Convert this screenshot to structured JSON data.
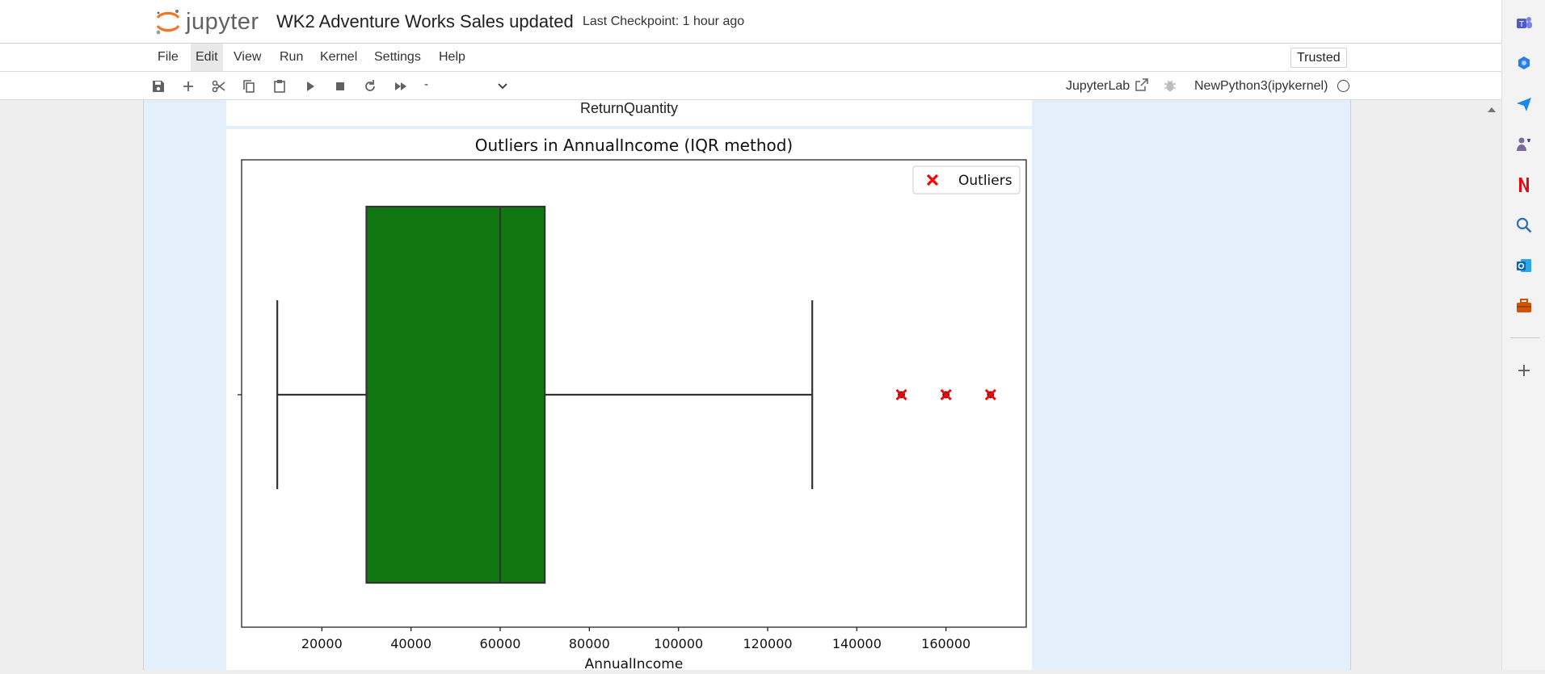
{
  "header": {
    "logo_text": "jupyter",
    "notebook_title": "WK2 Adventure Works Sales updated",
    "checkpoint": "Last Checkpoint: 1 hour ago"
  },
  "menu": {
    "items": [
      "File",
      "Edit",
      "View",
      "Run",
      "Kernel",
      "Settings",
      "Help"
    ],
    "active": "Edit",
    "trusted": "Trusted"
  },
  "toolbar": {
    "cell_type": "-",
    "jupyterlab_label": "JupyterLab",
    "kernel_name": "NewPython3(ipykernel)",
    "icons": [
      "save-icon",
      "add-icon",
      "cut-icon",
      "copy-icon",
      "paste-icon",
      "run-icon",
      "stop-icon",
      "restart-icon",
      "run-all-icon"
    ]
  },
  "previous_output": {
    "label": "ReturnQuantity"
  },
  "chart_data": {
    "type": "box",
    "title": "Outliers in AnnualIncome (IQR method)",
    "xlabel": "AnnualIncome",
    "ylabel": "",
    "xlim": [
      2000,
      178000
    ],
    "xticks": [
      20000,
      40000,
      60000,
      80000,
      100000,
      120000,
      140000,
      160000
    ],
    "box": {
      "whisker_low": 10000,
      "q1": 30000,
      "median": 60000,
      "q3": 70000,
      "whisker_high": 130000,
      "color": "#117711"
    },
    "outliers": [
      150000,
      160000,
      170000
    ],
    "outlier_color": "#ff0000",
    "legend": {
      "entries": [
        "Outliers"
      ],
      "placement": "top-right"
    }
  },
  "sidebar": {
    "icons": [
      "teams-icon",
      "copilot-icon",
      "send-icon",
      "games-icon",
      "netflix-icon",
      "search-icon",
      "outlook-icon",
      "toolbox-icon",
      "add-icon"
    ]
  }
}
